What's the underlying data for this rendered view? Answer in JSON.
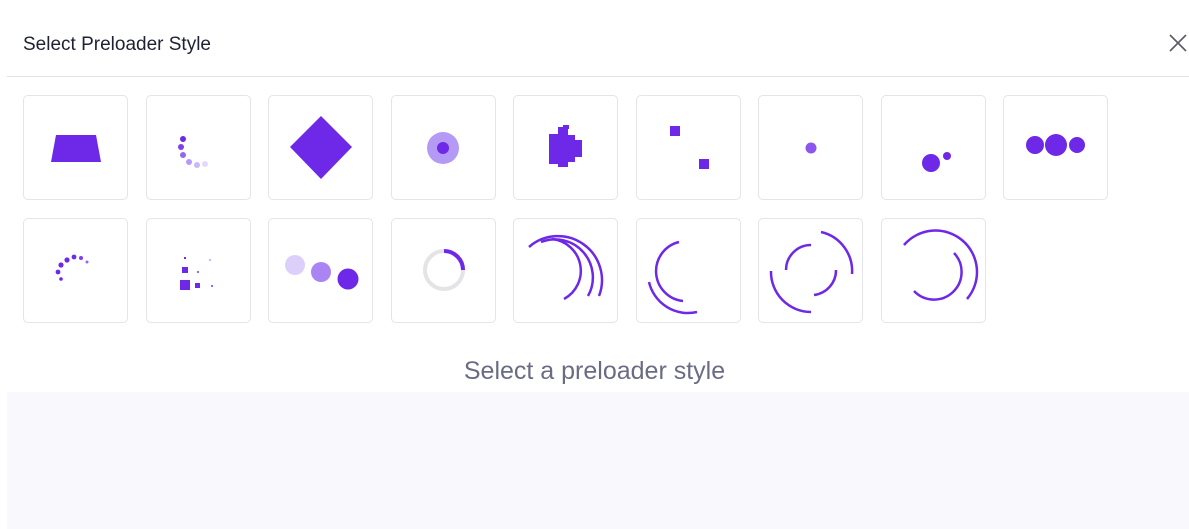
{
  "dialog": {
    "title": "Select Preloader Style",
    "close_icon": "close-icon"
  },
  "preloaders": [
    {
      "id": "trapezoid",
      "icon": "trapezoid-loader-icon"
    },
    {
      "id": "dots-arc",
      "icon": "dots-arc-loader-icon"
    },
    {
      "id": "diamond",
      "icon": "diamond-loader-icon"
    },
    {
      "id": "pulse-circle",
      "icon": "pulse-circle-loader-icon"
    },
    {
      "id": "pixel-blob",
      "icon": "pixel-blob-loader-icon"
    },
    {
      "id": "two-squares",
      "icon": "two-squares-loader-icon"
    },
    {
      "id": "single-dot",
      "icon": "single-dot-loader-icon"
    },
    {
      "id": "orbit-dots",
      "icon": "orbit-dots-loader-icon"
    },
    {
      "id": "three-dots",
      "icon": "three-dots-loader-icon"
    },
    {
      "id": "dot-spiral",
      "icon": "dot-spiral-loader-icon"
    },
    {
      "id": "scatter-squares",
      "icon": "scatter-squares-loader-icon"
    },
    {
      "id": "growing-dots",
      "icon": "growing-dots-loader-icon"
    },
    {
      "id": "ring-spinner",
      "icon": "ring-spinner-loader-icon"
    },
    {
      "id": "nested-arcs",
      "icon": "nested-arcs-loader-icon"
    },
    {
      "id": "double-arc",
      "icon": "double-arc-loader-icon"
    },
    {
      "id": "dashed-ring",
      "icon": "dashed-ring-loader-icon"
    },
    {
      "id": "open-arcs",
      "icon": "open-arcs-loader-icon"
    }
  ],
  "status_text": "Select a preloader style",
  "colors": {
    "accent": "#6d28e8",
    "accent_light": "#b59af5",
    "accent_pale": "#dcd0fb",
    "ring_gray": "#e4e4e6"
  }
}
